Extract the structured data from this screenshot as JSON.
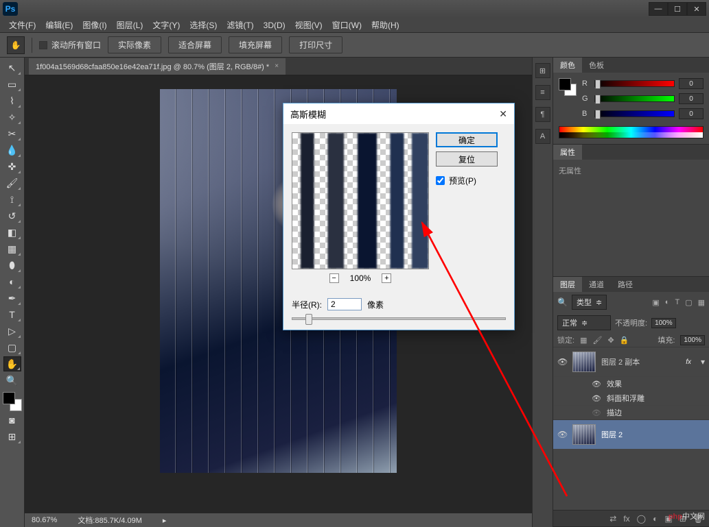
{
  "app": {
    "logo": "Ps"
  },
  "window_controls": {
    "min": "—",
    "restore": "☐",
    "close": "✕"
  },
  "menu": {
    "file": "文件(F)",
    "edit": "编辑(E)",
    "image": "图像(I)",
    "layer": "图层(L)",
    "type": "文字(Y)",
    "select": "选择(S)",
    "filter": "滤镜(T)",
    "three_d": "3D(D)",
    "view": "视图(V)",
    "window": "窗口(W)",
    "help": "帮助(H)"
  },
  "options": {
    "scroll_all": "滚动所有窗口",
    "actual_pixels": "实际像素",
    "fit_screen": "适合屏幕",
    "fill_screen": "填充屏幕",
    "print_size": "打印尺寸"
  },
  "doc_tab": {
    "title": "1f004a1569d68cfaa850e16e42ea71f.jpg @ 80.7% (图层 2, RGB/8#) *",
    "close": "×"
  },
  "status": {
    "zoom": "80.67%",
    "doc_size": "文档:885.7K/4.09M"
  },
  "dialog": {
    "title": "高斯模糊",
    "ok": "确定",
    "reset": "复位",
    "preview": "预览(P)",
    "zoom_pct": "100%",
    "minus": "−",
    "plus": "+",
    "radius_label": "半径(R):",
    "radius_value": "2",
    "radius_unit": "像素"
  },
  "panels": {
    "color_tab": "颜色",
    "swatches_tab": "色板",
    "rgb": {
      "r": "R",
      "g": "G",
      "b": "B",
      "r_val": "0",
      "g_val": "0",
      "b_val": "0"
    },
    "properties_tab": "属性",
    "no_properties": "无属性",
    "layers_tab": "图层",
    "channels_tab": "通道",
    "paths_tab": "路径",
    "type_filter": "类型",
    "search_icon": "🔍",
    "blend_mode": "正常",
    "opacity_label": "不透明度:",
    "opacity_val": "100%",
    "lock_label": "锁定:",
    "fill_label": "填充:",
    "fill_val": "100%",
    "layer_copy": "图层 2 副本",
    "fx": "fx",
    "effects": "效果",
    "bevel": "斜面和浮雕",
    "stroke": "描边",
    "layer2": "图层 2",
    "chevron": "▾",
    "chevron_r": "▸"
  },
  "watermark": {
    "text_a": "php",
    "text_b": "中文网"
  }
}
